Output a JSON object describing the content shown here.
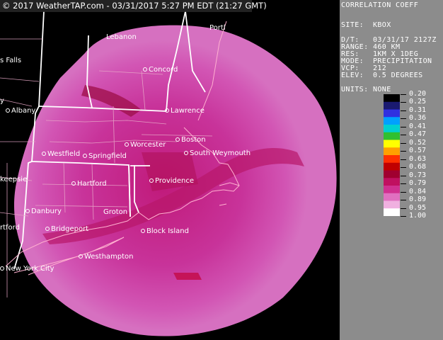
{
  "header": {
    "text": "© 2017 WeatherTAP.com - 03/31/2017  5:27 PM EDT (21:27 GMT)"
  },
  "product": {
    "title": "CORRELATION COEFF",
    "site": "SITE:  KBOX",
    "dt": "D/T:   03/31/17 2127Z",
    "range": "RANGE: 460 KM",
    "res": "RES:   1KM X 1DEG",
    "mode": "MODE:  PRECIPITATION",
    "vcp": "VCP:   212",
    "elev": "ELEV:  0.5 DEGREES",
    "units": "UNITS: NONE"
  },
  "legend": {
    "ticks": [
      "0.20",
      "0.25",
      "0.31",
      "0.36",
      "0.41",
      "0.47",
      "0.52",
      "0.57",
      "0.63",
      "0.68",
      "0.73",
      "0.79",
      "0.84",
      "0.89",
      "0.95",
      "1.00"
    ],
    "colors": [
      "#000000",
      "#1a1a70",
      "#3030e0",
      "#00a0ff",
      "#00d0d0",
      "#30c030",
      "#ffff00",
      "#ffa000",
      "#ff3000",
      "#c00000",
      "#a00030",
      "#c01060",
      "#d03090",
      "#e070c0",
      "#f0b0e0",
      "#ffffff"
    ]
  },
  "cities": {
    "portland": "Portl",
    "lebanon": "Lebanon",
    "concord": "Concord",
    "lawrence": "Lawrence",
    "boston": "Boston",
    "south_weymouth": "South Weymouth",
    "worcester": "Worcester",
    "westfield": "Westfield",
    "springfield": "Springfield",
    "albany": "Albany",
    "hartford": "Hartford",
    "providence": "Providence",
    "groton": "Groton",
    "block_island": "Block Island",
    "danbury": "Danbury",
    "bridgeport": "Bridgeport",
    "westhampton": "Westhampton",
    "new_york_city": "New York City",
    "falls": "s Falls",
    "kingston": "keepsie",
    "hartford_w": "rtford",
    "ny_edge": "y"
  }
}
